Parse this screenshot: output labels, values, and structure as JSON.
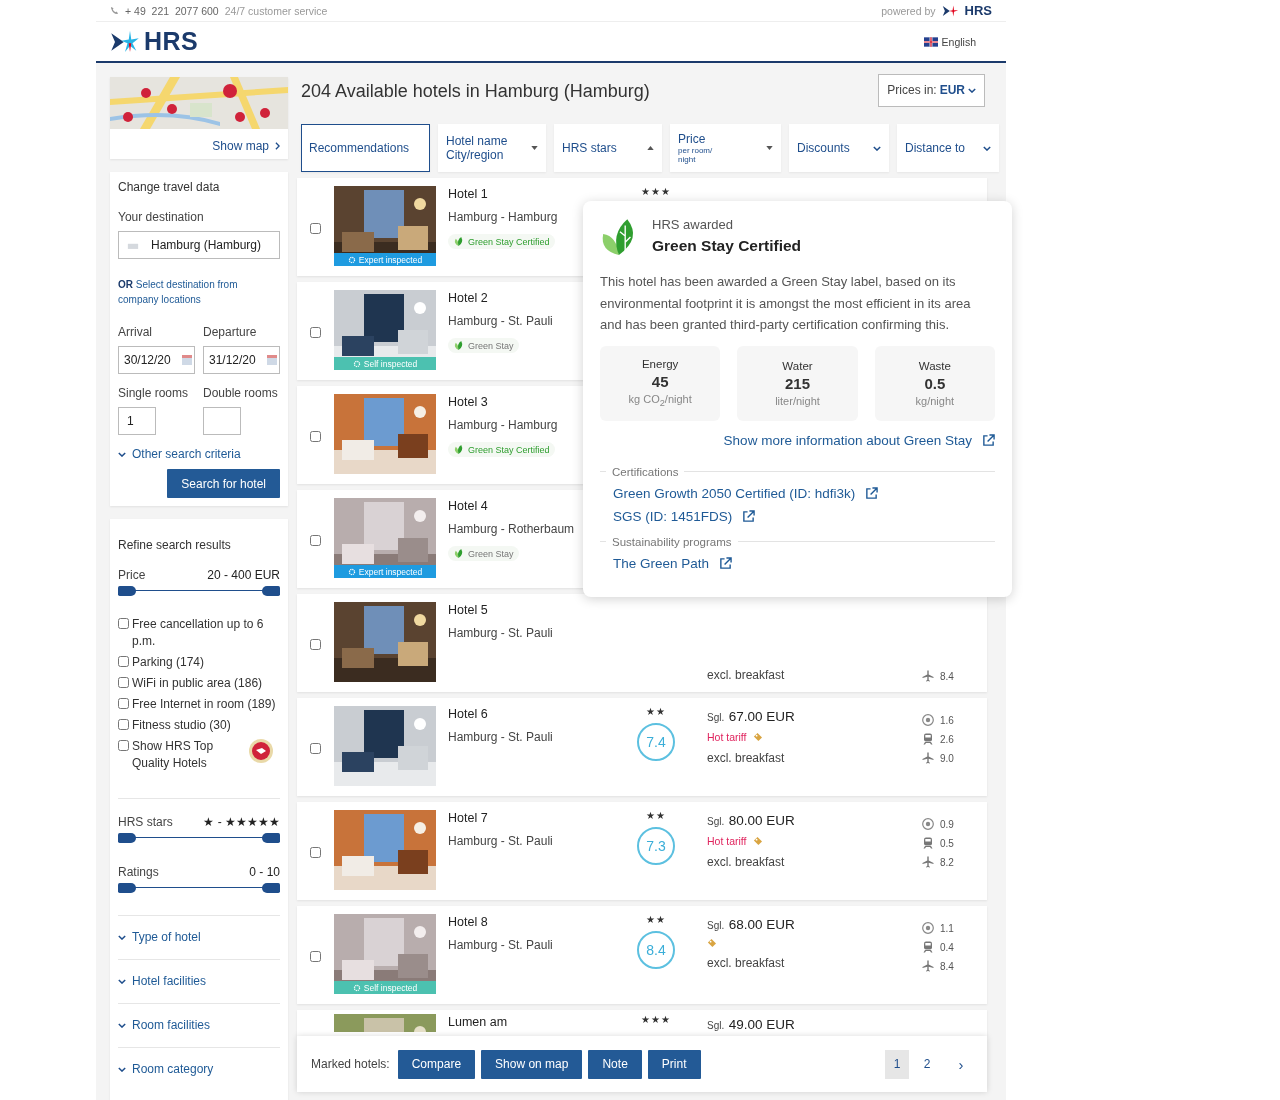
{
  "topbar": {
    "phone": "+ 49  221  2077 600",
    "service": "24/7 customer service",
    "powered_by": "powered by",
    "powered_logo": "HRS"
  },
  "header": {
    "logo": "HRS",
    "language": "English"
  },
  "sidebar": {
    "map_link": "Show map",
    "travel": {
      "title": "Change travel data",
      "destination_label": "Your destination",
      "destination": "Hamburg (Hamburg)",
      "company_link": "**OR** Select destination from company locations",
      "arrival_label": "Arrival",
      "arrival": "30/12/20",
      "departure_label": "Departure",
      "departure": "31/12/20",
      "single_label": "Single rooms",
      "single": "1",
      "double_label": "Double rooms",
      "more_criteria": {
        "label": "Other search criteria",
        "expanded": false
      },
      "search_button": "Search for hotel"
    },
    "refine": {
      "title": "Refine search results",
      "price_range": {
        "label": "Price",
        "reading": "20 - 400 EUR",
        "level": 1
      },
      "filters": [
        {
          "label": "Free cancellation up to 6 p.m.",
          "checked": false,
          "kind": "plain"
        },
        {
          "label": "Parking (174)",
          "checked": false,
          "kind": "plain"
        },
        {
          "label": "WiFi in public area (186)",
          "checked": false,
          "kind": "plain"
        },
        {
          "label": "Free Internet in room (189)",
          "checked": false,
          "kind": "plain"
        },
        {
          "label": "Fitness studio (30)",
          "checked": false,
          "kind": "plain"
        },
        {
          "label": "Show HRS Top Quality Hotels",
          "checked": false,
          "kind": "top-quality"
        }
      ],
      "ranges": [
        {
          "label": "HRS stars",
          "reading": "★ - ★★★★★",
          "level": 1
        },
        {
          "label": "Ratings",
          "reading": "0 - 10",
          "level": 1
        }
      ],
      "sections": [
        {
          "label": "Type of hotel",
          "expanded": false
        },
        {
          "label": "Hotel facilities",
          "expanded": false
        },
        {
          "label": "Room facilities",
          "expanded": false
        },
        {
          "label": "Room category",
          "expanded": false
        }
      ]
    }
  },
  "main": {
    "title": "204 Available hotels in Hamburg (Hamburg)",
    "currency_label": "Prices in:",
    "currency": "EUR",
    "sort_tabs": [
      {
        "label": "Recommendations",
        "selected": true,
        "kind": "plain"
      },
      {
        "label": "Hotel name",
        "label2": "City/region",
        "selected": false,
        "kind": "sort-down"
      },
      {
        "label": "HRS stars",
        "selected": false,
        "kind": "sort-up"
      },
      {
        "label": "Price",
        "note": "per room/ night",
        "selected": false,
        "kind": "sort-down"
      },
      {
        "label": "Discounts",
        "selected": false,
        "kind": "dropdown"
      },
      {
        "label": "Distance to",
        "selected": false,
        "kind": "dropdown"
      }
    ],
    "hotels": [
      {
        "kind": "full",
        "checked": false,
        "name": "Hotel 1",
        "location": "Hamburg - Hamburg",
        "inspected": {
          "label": "Expert inspected",
          "kind": "expert"
        },
        "green": {
          "label": "Green Stay Certified",
          "kind": "certified"
        },
        "stars": "★★★"
      },
      {
        "kind": "full",
        "checked": false,
        "name": "Hotel 2",
        "location": "Hamburg - St. Pauli",
        "inspected": {
          "label": "Self inspected",
          "kind": "self"
        },
        "green": {
          "label": "Green Stay",
          "kind": "basic"
        }
      },
      {
        "kind": "full",
        "checked": false,
        "name": "Hotel 3",
        "location": "Hamburg - Hamburg",
        "green": {
          "label": "Green Stay Certified",
          "kind": "certified"
        }
      },
      {
        "kind": "full",
        "checked": false,
        "name": "Hotel 4",
        "location": "Hamburg - Rotherbaum",
        "inspected": {
          "label": "Expert inspected",
          "kind": "expert"
        },
        "green": {
          "label": "Green Stay",
          "kind": "basic"
        }
      },
      {
        "kind": "full",
        "checked": false,
        "name": "Hotel 5",
        "location": "Hamburg - St. Pauli",
        "breakfast": "excl. breakfast",
        "distances": [
          {
            "kind": "airport",
            "value": "8.4"
          }
        ]
      },
      {
        "kind": "full",
        "checked": false,
        "name": "Hotel 6",
        "location": "Hamburg - St. Pauli",
        "stars": "★★",
        "score": "7.4",
        "price_prefix": "Sgl.",
        "price": "67.00 EUR",
        "tariff": "Hot tariff",
        "tag": true,
        "breakfast": "excl. breakfast",
        "distances": [
          {
            "kind": "center",
            "value": "1.6"
          },
          {
            "kind": "train",
            "value": "2.6"
          },
          {
            "kind": "airport",
            "value": "9.0"
          }
        ]
      },
      {
        "kind": "full",
        "checked": false,
        "name": "Hotel 7",
        "location": "Hamburg - St. Pauli",
        "stars": "★★",
        "score": "7.3",
        "price_prefix": "Sgl.",
        "price": "80.00 EUR",
        "tariff": "Hot tariff",
        "tag": true,
        "breakfast": "excl. breakfast",
        "distances": [
          {
            "kind": "center",
            "value": "0.9"
          },
          {
            "kind": "train",
            "value": "0.5"
          },
          {
            "kind": "airport",
            "value": "8.2"
          }
        ]
      },
      {
        "kind": "full",
        "checked": false,
        "name": "Hotel 8",
        "location": "Hamburg - St. Pauli",
        "inspected": {
          "label": "Self inspected",
          "kind": "self"
        },
        "stars": "★★",
        "score": "8.4",
        "price_prefix": "Sgl.",
        "price": "68.00 EUR",
        "tag": true,
        "breakfast": "excl. breakfast",
        "distances": [
          {
            "kind": "center",
            "value": "1.1"
          },
          {
            "kind": "train",
            "value": "0.4"
          },
          {
            "kind": "airport",
            "value": "8.4"
          }
        ]
      },
      {
        "kind": "partial",
        "name": "Lumen am",
        "stars": "★★★",
        "price_prefix": "Sgl.",
        "price": "49.00 EUR"
      }
    ],
    "footer": {
      "label": "Marked hotels:",
      "buttons": [
        "Compare",
        "Show on map",
        "Note",
        "Print"
      ],
      "pages": [
        {
          "label": "1",
          "selected": true
        },
        {
          "label": "2",
          "selected": false
        }
      ],
      "next": "›"
    },
    "popover": {
      "overline": "HRS awarded",
      "title": "Green Stay Certified",
      "text": "This hotel has been awarded a Green Stay label, based on its environmental footprint it is amongst the most efficient in its area and has been granted third-party certification confirming this.",
      "metrics": [
        {
          "label": "Energy",
          "value": "45",
          "unit": "kg CO$_{2}$/night"
        },
        {
          "label": "Water",
          "value": "215",
          "unit": "liter/night"
        },
        {
          "label": "Waste",
          "value": "0.5",
          "unit": "kg/night"
        }
      ],
      "more_link": "Show more information about Green Stay",
      "sections": [
        {
          "title": "Certifications",
          "links": [
            "Green Growth 2050 Certified (ID: hdfi3k)",
            "SGS (ID: 1451FDS)"
          ]
        },
        {
          "title": "Sustainability programs",
          "links": [
            "The Green Path"
          ]
        }
      ]
    }
  }
}
